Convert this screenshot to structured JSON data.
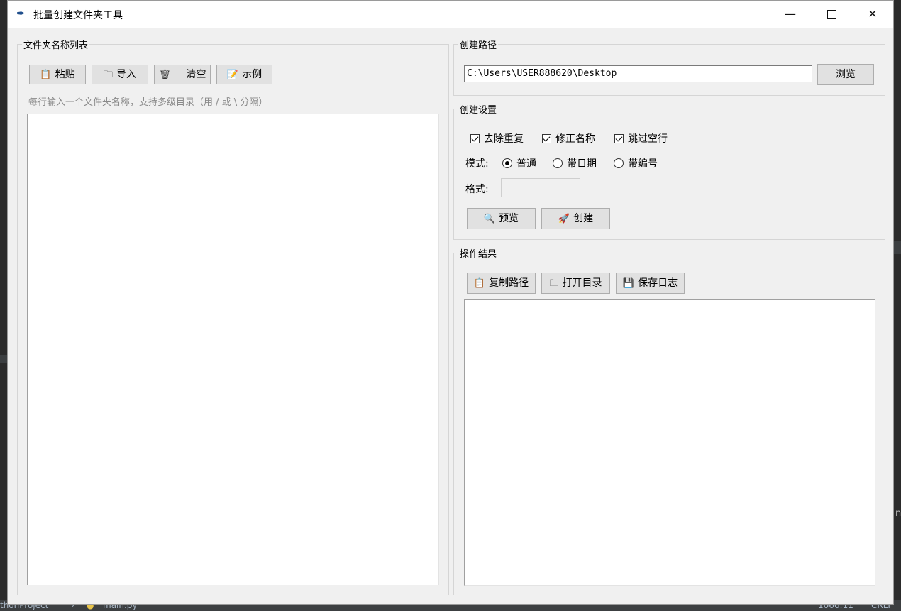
{
  "window": {
    "title": "批量创建文件夹工具"
  },
  "left": {
    "frame_title": "文件夹名称列表",
    "buttons": {
      "paste": "粘贴",
      "import": "导入",
      "clear": "清空",
      "example": "示例"
    },
    "hint": "每行输入一个文件夹名称，支持多级目录（用 / 或 \\ 分隔）"
  },
  "path": {
    "frame_title": "创建路径",
    "value": "C:\\Users\\USER888620\\Desktop",
    "browse": "浏览"
  },
  "settings": {
    "frame_title": "创建设置",
    "options": {
      "dedupe": "去除重复",
      "fix_names": "修正名称",
      "skip_empty": "跳过空行"
    },
    "mode_label": "模式:",
    "modes": {
      "normal": "普通",
      "with_date": "带日期",
      "with_number": "带编号"
    },
    "format_label": "格式:",
    "preview": "预览",
    "create": "创建"
  },
  "results": {
    "frame_title": "操作结果",
    "buttons": {
      "copy_path": "复制路径",
      "open_dir": "打开目录",
      "save_log": "保存日志"
    }
  },
  "ide": {
    "project": "thonProject",
    "file": "main.py",
    "position": "1066:11",
    "line_ending": "CRLF",
    "right_text": "n"
  }
}
